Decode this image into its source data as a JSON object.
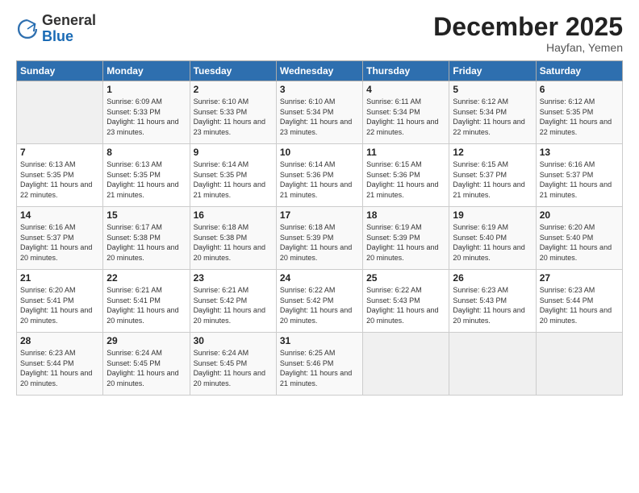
{
  "header": {
    "logo_general": "General",
    "logo_blue": "Blue",
    "month_title": "December 2025",
    "location": "Hayfan, Yemen"
  },
  "days_of_week": [
    "Sunday",
    "Monday",
    "Tuesday",
    "Wednesday",
    "Thursday",
    "Friday",
    "Saturday"
  ],
  "weeks": [
    [
      {
        "day": "",
        "sunrise": "",
        "sunset": "",
        "daylight": "",
        "empty": true
      },
      {
        "day": "1",
        "sunrise": "Sunrise: 6:09 AM",
        "sunset": "Sunset: 5:33 PM",
        "daylight": "Daylight: 11 hours and 23 minutes."
      },
      {
        "day": "2",
        "sunrise": "Sunrise: 6:10 AM",
        "sunset": "Sunset: 5:33 PM",
        "daylight": "Daylight: 11 hours and 23 minutes."
      },
      {
        "day": "3",
        "sunrise": "Sunrise: 6:10 AM",
        "sunset": "Sunset: 5:34 PM",
        "daylight": "Daylight: 11 hours and 23 minutes."
      },
      {
        "day": "4",
        "sunrise": "Sunrise: 6:11 AM",
        "sunset": "Sunset: 5:34 PM",
        "daylight": "Daylight: 11 hours and 22 minutes."
      },
      {
        "day": "5",
        "sunrise": "Sunrise: 6:12 AM",
        "sunset": "Sunset: 5:34 PM",
        "daylight": "Daylight: 11 hours and 22 minutes."
      },
      {
        "day": "6",
        "sunrise": "Sunrise: 6:12 AM",
        "sunset": "Sunset: 5:35 PM",
        "daylight": "Daylight: 11 hours and 22 minutes."
      }
    ],
    [
      {
        "day": "7",
        "sunrise": "Sunrise: 6:13 AM",
        "sunset": "Sunset: 5:35 PM",
        "daylight": "Daylight: 11 hours and 22 minutes."
      },
      {
        "day": "8",
        "sunrise": "Sunrise: 6:13 AM",
        "sunset": "Sunset: 5:35 PM",
        "daylight": "Daylight: 11 hours and 21 minutes."
      },
      {
        "day": "9",
        "sunrise": "Sunrise: 6:14 AM",
        "sunset": "Sunset: 5:35 PM",
        "daylight": "Daylight: 11 hours and 21 minutes."
      },
      {
        "day": "10",
        "sunrise": "Sunrise: 6:14 AM",
        "sunset": "Sunset: 5:36 PM",
        "daylight": "Daylight: 11 hours and 21 minutes."
      },
      {
        "day": "11",
        "sunrise": "Sunrise: 6:15 AM",
        "sunset": "Sunset: 5:36 PM",
        "daylight": "Daylight: 11 hours and 21 minutes."
      },
      {
        "day": "12",
        "sunrise": "Sunrise: 6:15 AM",
        "sunset": "Sunset: 5:37 PM",
        "daylight": "Daylight: 11 hours and 21 minutes."
      },
      {
        "day": "13",
        "sunrise": "Sunrise: 6:16 AM",
        "sunset": "Sunset: 5:37 PM",
        "daylight": "Daylight: 11 hours and 21 minutes."
      }
    ],
    [
      {
        "day": "14",
        "sunrise": "Sunrise: 6:16 AM",
        "sunset": "Sunset: 5:37 PM",
        "daylight": "Daylight: 11 hours and 20 minutes."
      },
      {
        "day": "15",
        "sunrise": "Sunrise: 6:17 AM",
        "sunset": "Sunset: 5:38 PM",
        "daylight": "Daylight: 11 hours and 20 minutes."
      },
      {
        "day": "16",
        "sunrise": "Sunrise: 6:18 AM",
        "sunset": "Sunset: 5:38 PM",
        "daylight": "Daylight: 11 hours and 20 minutes."
      },
      {
        "day": "17",
        "sunrise": "Sunrise: 6:18 AM",
        "sunset": "Sunset: 5:39 PM",
        "daylight": "Daylight: 11 hours and 20 minutes."
      },
      {
        "day": "18",
        "sunrise": "Sunrise: 6:19 AM",
        "sunset": "Sunset: 5:39 PM",
        "daylight": "Daylight: 11 hours and 20 minutes."
      },
      {
        "day": "19",
        "sunrise": "Sunrise: 6:19 AM",
        "sunset": "Sunset: 5:40 PM",
        "daylight": "Daylight: 11 hours and 20 minutes."
      },
      {
        "day": "20",
        "sunrise": "Sunrise: 6:20 AM",
        "sunset": "Sunset: 5:40 PM",
        "daylight": "Daylight: 11 hours and 20 minutes."
      }
    ],
    [
      {
        "day": "21",
        "sunrise": "Sunrise: 6:20 AM",
        "sunset": "Sunset: 5:41 PM",
        "daylight": "Daylight: 11 hours and 20 minutes."
      },
      {
        "day": "22",
        "sunrise": "Sunrise: 6:21 AM",
        "sunset": "Sunset: 5:41 PM",
        "daylight": "Daylight: 11 hours and 20 minutes."
      },
      {
        "day": "23",
        "sunrise": "Sunrise: 6:21 AM",
        "sunset": "Sunset: 5:42 PM",
        "daylight": "Daylight: 11 hours and 20 minutes."
      },
      {
        "day": "24",
        "sunrise": "Sunrise: 6:22 AM",
        "sunset": "Sunset: 5:42 PM",
        "daylight": "Daylight: 11 hours and 20 minutes."
      },
      {
        "day": "25",
        "sunrise": "Sunrise: 6:22 AM",
        "sunset": "Sunset: 5:43 PM",
        "daylight": "Daylight: 11 hours and 20 minutes."
      },
      {
        "day": "26",
        "sunrise": "Sunrise: 6:23 AM",
        "sunset": "Sunset: 5:43 PM",
        "daylight": "Daylight: 11 hours and 20 minutes."
      },
      {
        "day": "27",
        "sunrise": "Sunrise: 6:23 AM",
        "sunset": "Sunset: 5:44 PM",
        "daylight": "Daylight: 11 hours and 20 minutes."
      }
    ],
    [
      {
        "day": "28",
        "sunrise": "Sunrise: 6:23 AM",
        "sunset": "Sunset: 5:44 PM",
        "daylight": "Daylight: 11 hours and 20 minutes."
      },
      {
        "day": "29",
        "sunrise": "Sunrise: 6:24 AM",
        "sunset": "Sunset: 5:45 PM",
        "daylight": "Daylight: 11 hours and 20 minutes."
      },
      {
        "day": "30",
        "sunrise": "Sunrise: 6:24 AM",
        "sunset": "Sunset: 5:45 PM",
        "daylight": "Daylight: 11 hours and 20 minutes."
      },
      {
        "day": "31",
        "sunrise": "Sunrise: 6:25 AM",
        "sunset": "Sunset: 5:46 PM",
        "daylight": "Daylight: 11 hours and 21 minutes."
      },
      {
        "day": "",
        "sunrise": "",
        "sunset": "",
        "daylight": "",
        "empty": true
      },
      {
        "day": "",
        "sunrise": "",
        "sunset": "",
        "daylight": "",
        "empty": true
      },
      {
        "day": "",
        "sunrise": "",
        "sunset": "",
        "daylight": "",
        "empty": true
      }
    ]
  ]
}
